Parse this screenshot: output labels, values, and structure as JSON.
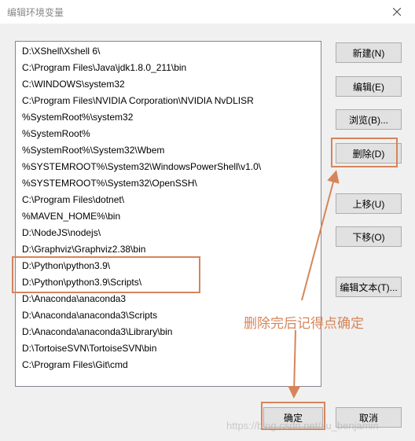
{
  "window": {
    "title": "编辑环境变量"
  },
  "list": {
    "items": [
      "D:\\XShell\\Xshell 6\\",
      "C:\\Program Files\\Java\\jdk1.8.0_211\\bin",
      "C:\\WINDOWS\\system32",
      "C:\\Program Files\\NVIDIA Corporation\\NVIDIA NvDLISR",
      "%SystemRoot%\\system32",
      "%SystemRoot%",
      "%SystemRoot%\\System32\\Wbem",
      "%SYSTEMROOT%\\System32\\WindowsPowerShell\\v1.0\\",
      "%SYSTEMROOT%\\System32\\OpenSSH\\",
      "C:\\Program Files\\dotnet\\",
      "%MAVEN_HOME%\\bin",
      "D:\\NodeJS\\nodejs\\",
      "D:\\Graphviz\\Graphviz2.38\\bin",
      "D:\\Python\\python3.9\\",
      "D:\\Python\\python3.9\\Scripts\\",
      "D:\\Anaconda\\anaconda3",
      "D:\\Anaconda\\anaconda3\\Scripts",
      "D:\\Anaconda\\anaconda3\\Library\\bin",
      "D:\\TortoiseSVN\\TortoiseSVN\\bin",
      "C:\\Program Files\\Git\\cmd"
    ]
  },
  "buttons": {
    "new": "新建(N)",
    "edit": "编辑(E)",
    "browse": "浏览(B)...",
    "delete": "删除(D)",
    "move_up": "上移(U)",
    "move_down": "下移(O)",
    "edit_text": "编辑文本(T)...",
    "ok": "确定",
    "cancel": "取消"
  },
  "annotation": {
    "text": "删除完后记得点确定"
  },
  "watermark": "https://blog.csdn.net/xu_benjamin",
  "colors": {
    "annotation": "#d6855a",
    "window_bg": "#f0f0f0",
    "button_bg": "#e1e1e1"
  }
}
